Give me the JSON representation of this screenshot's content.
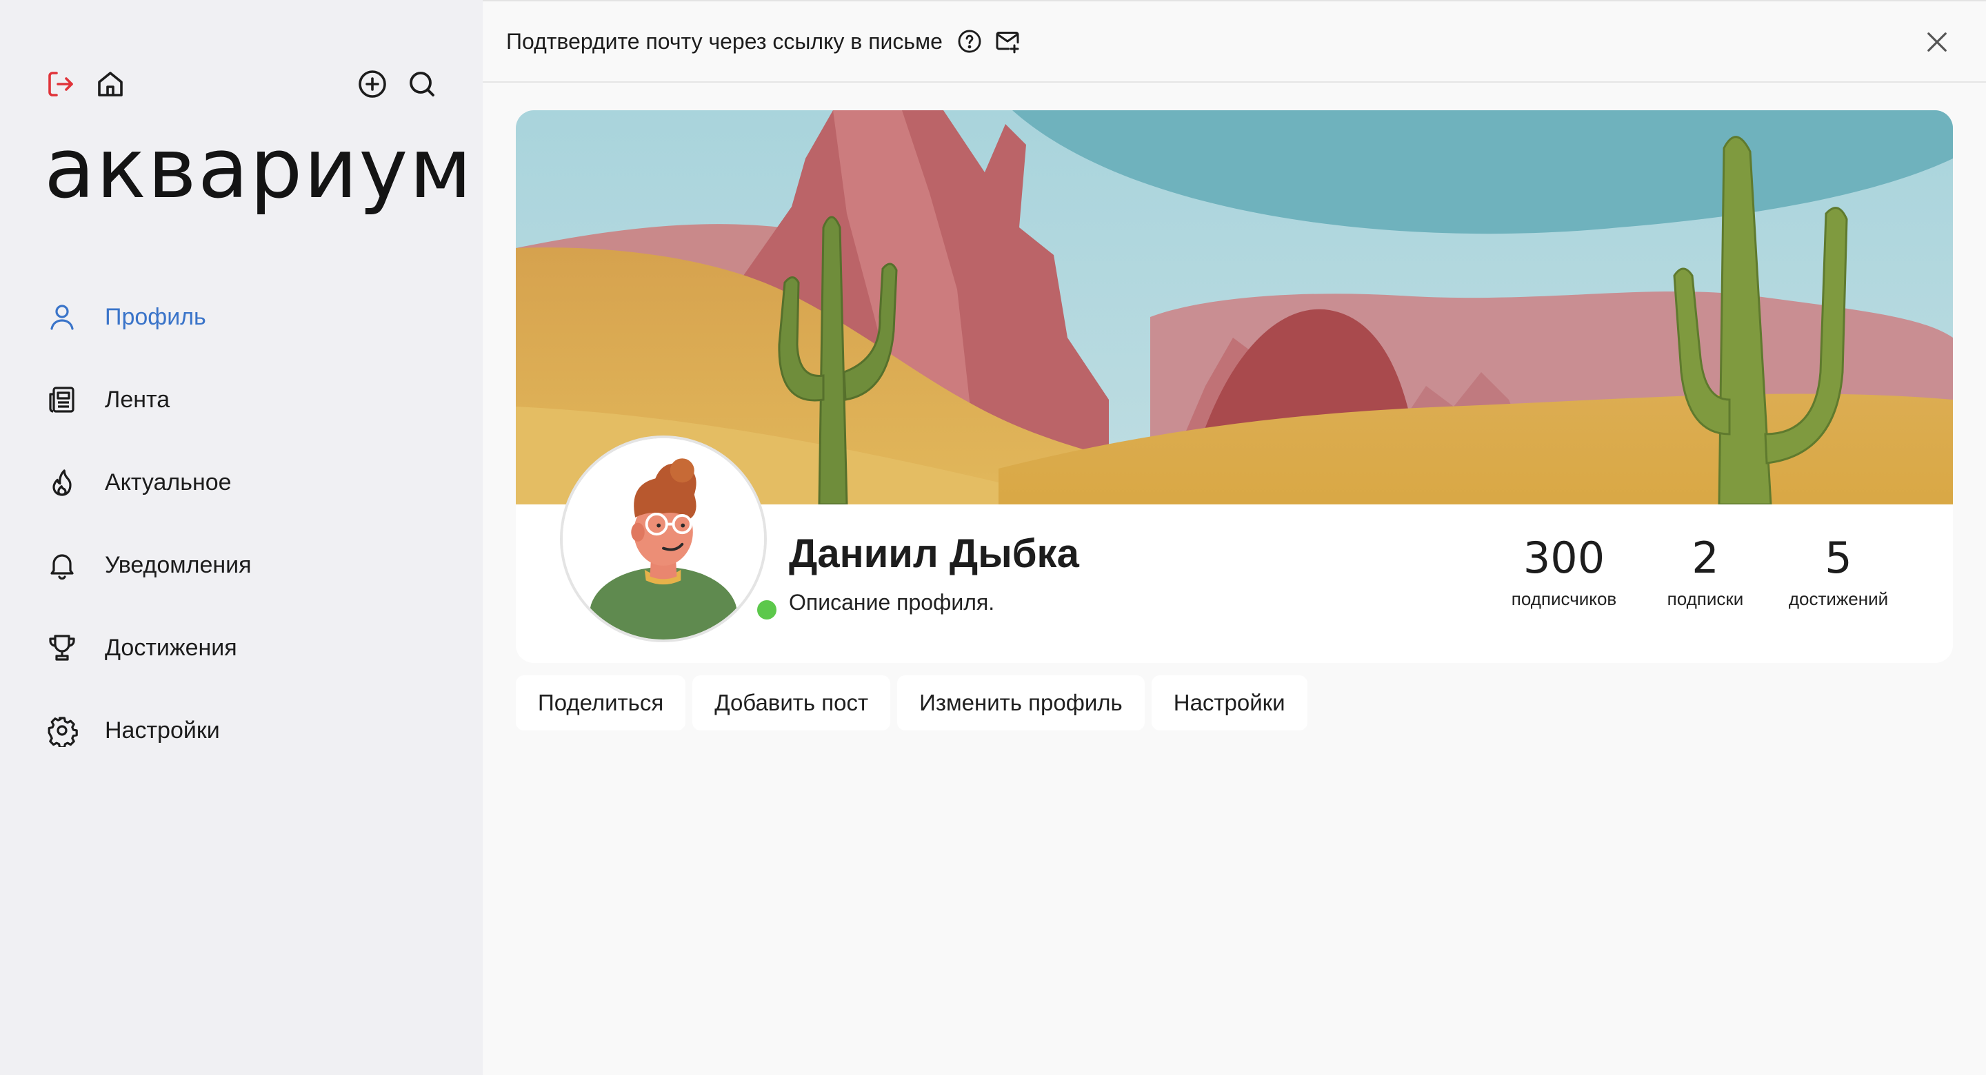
{
  "app": {
    "logo": "аквариум"
  },
  "sidebar": {
    "top_icons": {
      "logout": "logout-icon",
      "home": "home-icon",
      "add": "plus-circle-icon",
      "search": "search-icon"
    },
    "items": [
      {
        "label": "Профиль",
        "icon": "user-icon",
        "active": true
      },
      {
        "label": "Лента",
        "icon": "newspaper-icon",
        "active": false
      },
      {
        "label": "Актуальное",
        "icon": "flame-icon",
        "active": false
      },
      {
        "label": "Уведомления",
        "icon": "bell-icon",
        "active": false
      },
      {
        "label": "Достижения",
        "icon": "trophy-icon",
        "active": false
      },
      {
        "label": "Настройки",
        "icon": "gear-icon",
        "active": false
      }
    ]
  },
  "banner": {
    "text": "Подтвердите почту через ссылку в письме"
  },
  "profile": {
    "name": "Даниил Дыбка",
    "description": "Описание профиля.",
    "online": true,
    "stats": [
      {
        "value": "300",
        "label": "подписчиков"
      },
      {
        "value": "2",
        "label": "подписки"
      },
      {
        "value": "5",
        "label": "достижений"
      }
    ]
  },
  "actions": {
    "share": "Поделиться",
    "add_post": "Добавить пост",
    "edit_profile": "Изменить профиль",
    "settings": "Настройки"
  },
  "colors": {
    "accent": "#3a74c9",
    "logout": "#e0343a",
    "online": "#5cc84b",
    "sidebar_bg": "#f0f0f3",
    "main_bg": "#f9f9f9"
  }
}
